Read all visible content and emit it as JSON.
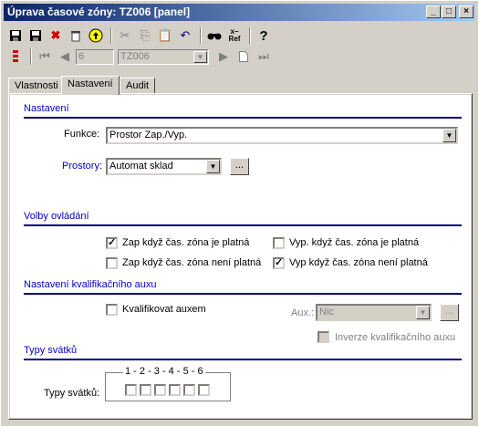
{
  "window": {
    "title": "Úprava časové zóny: TZ006 [panel]"
  },
  "window_buttons": {
    "minimize": "_",
    "maximize": "□",
    "close": "×"
  },
  "toolbar": {
    "icons": [
      "save-icon",
      "save-all-icon",
      "delete-icon",
      "trash-icon",
      "upload-icon",
      "cut-icon",
      "copy-icon",
      "paste-icon",
      "undo-icon",
      "find-icon",
      "ref-icon",
      "help-icon"
    ],
    "ref_label": "Ref"
  },
  "navigator": {
    "record_number": "6",
    "record_code": "TZ006"
  },
  "tabs": [
    "Vlastnosti",
    "Nastavení",
    "Audit"
  ],
  "active_tab": "Nastavení",
  "nastaveni": {
    "section_title": "Nastavení",
    "funkce_label": "Funkce:",
    "funkce_value": "Prostor Zap./Vyp.",
    "prostory_label": "Prostory:",
    "prostory_value": "Automat sklad",
    "dots": "..."
  },
  "volby": {
    "section_title": "Volby ovládání",
    "options": [
      {
        "label": "Zap když čas. zóna je platná",
        "checked": true
      },
      {
        "label": "Vyp. když čas. zóna je platná",
        "checked": false
      },
      {
        "label": "Zap když čas. zóna není platná",
        "checked": false
      },
      {
        "label": "Vyp když čas. zóna není platná",
        "checked": true
      }
    ]
  },
  "kvalifikace": {
    "section_title": "Nastavení kvalifikačního auxu",
    "kvalifikovat_label": "Kvalifikovat auxem",
    "aux_label": "Aux.:",
    "aux_value": "Nic",
    "inverze_label": "Inverze kvalifikačního auxu",
    "dots": "..."
  },
  "svatky": {
    "section_title": "Typy svátků",
    "field_label": "Typy svátků:",
    "numbers": "1 - 2 - 3 - 4 - 5 - 6",
    "checks": [
      false,
      false,
      false,
      false,
      false,
      false
    ]
  }
}
